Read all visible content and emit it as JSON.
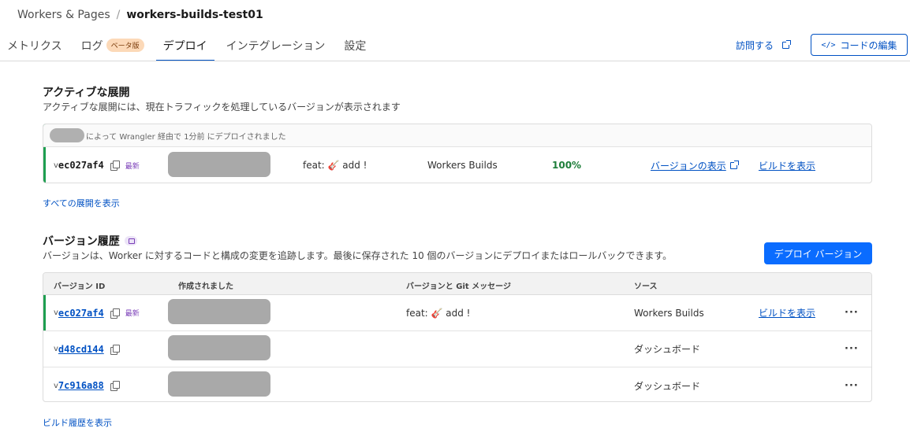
{
  "breadcrumb": {
    "parent": "Workers & Pages",
    "separator": "/",
    "current": "workers-builds-test01"
  },
  "tabs": [
    {
      "label": "メトリクス"
    },
    {
      "label": "ログ",
      "badge": "ベータ版"
    },
    {
      "label": "デプロイ",
      "active": true
    },
    {
      "label": "インテグレーション"
    },
    {
      "label": "設定"
    }
  ],
  "header_actions": {
    "visit_label": "訪問する",
    "edit_code_label": "コードの編集",
    "edit_code_icon": "</>"
  },
  "active_deployment": {
    "title": "アクティブな展開",
    "description": "アクティブな展開には、現在トラフィックを処理しているバージョンが表示されます",
    "meta_text": "によって Wrangler 経由で 1分前 にデプロイされました",
    "row": {
      "v_prefix": "v",
      "version_id": "ec027af4",
      "latest_label": "最新",
      "message": "feat: 🎸 add !",
      "source": "Workers Builds",
      "percentage": "100%",
      "view_version_label": "バージョンの表示",
      "view_build_label": "ビルドを表示"
    },
    "all_deployments_link": "すべての展開を表示"
  },
  "version_history": {
    "title": "バージョン履歴",
    "description": "バージョンは、Worker に対するコードと構成の変更を追跡します。最後に保存された 10 個のバージョンにデプロイまたはロールバックできます。",
    "deploy_button_label": "デプロイ バージョン",
    "columns": {
      "version_id": "バージョン ID",
      "created": "作成されました",
      "message": "バージョンと Git メッセージ",
      "source": "ソース"
    },
    "rows": [
      {
        "v_prefix": "v",
        "version_id": "ec027af4",
        "latest_label": "最新",
        "message": "feat: 🎸 add !",
        "source": "Workers Builds",
        "build_link": "ビルドを表示",
        "menu": "···"
      },
      {
        "v_prefix": "v",
        "version_id": "d48cd144",
        "latest_label": "",
        "message": "",
        "source": "ダッシュボード",
        "build_link": "",
        "menu": "···"
      },
      {
        "v_prefix": "v",
        "version_id": "7c916a88",
        "latest_label": "",
        "message": "",
        "source": "ダッシュボード",
        "build_link": "",
        "menu": "···"
      }
    ],
    "build_history_link": "ビルド履歴を表示"
  },
  "colors": {
    "accent": "#0051c3",
    "primary_button": "#0a6cff",
    "active_bar": "#1e9e50",
    "latest_tag": "#7b3fb8"
  }
}
